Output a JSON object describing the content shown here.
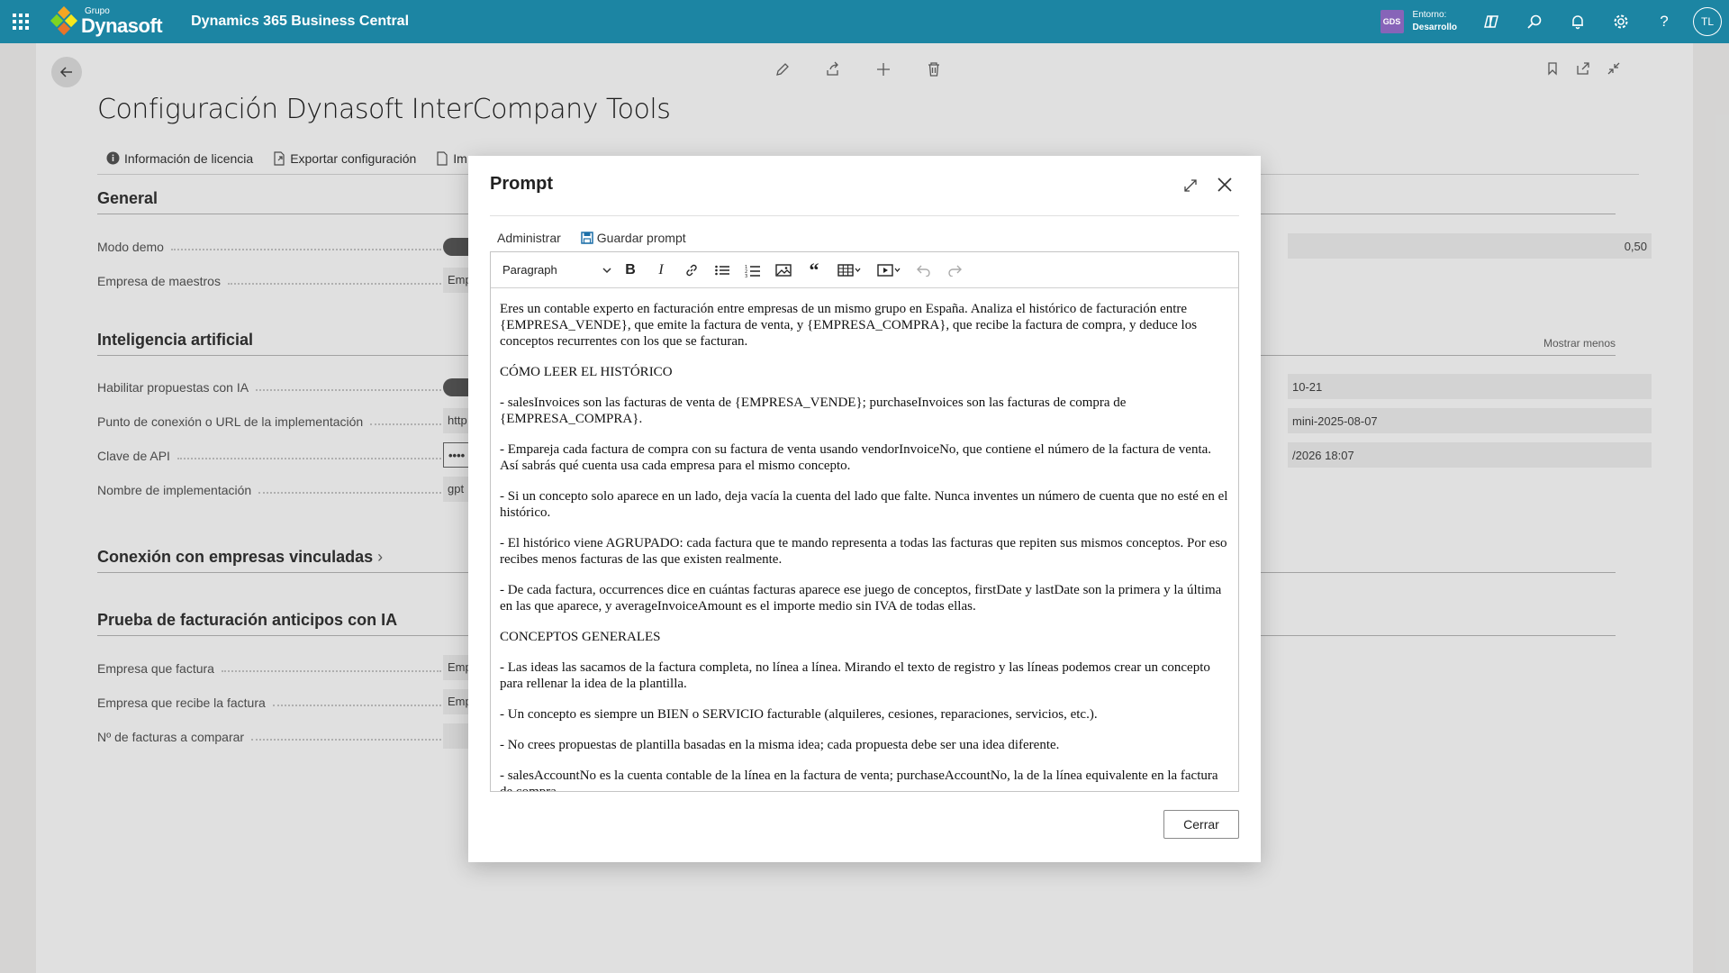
{
  "topbar": {
    "brand_small": "Grupo",
    "brand_big": "Dynasoft",
    "app_title": "Dynamics 365 Business Central",
    "env_badge": "GDS",
    "env_label": "Entorno:",
    "env_value": "Desarrollo",
    "avatar_initials": "TL"
  },
  "page": {
    "title": "Configuración Dynasoft InterCompany Tools",
    "actions": [
      {
        "label": "Información de licencia",
        "icon": "info-icon"
      },
      {
        "label": "Exportar configuración",
        "icon": "export-icon"
      },
      {
        "label": "Im",
        "icon": "import-icon"
      }
    ],
    "sections": {
      "general": {
        "title": "General",
        "fields": [
          {
            "label": "Modo demo",
            "type": "toggle"
          },
          {
            "label": "Empresa de maestros",
            "value": "Emp"
          }
        ],
        "right_value": "0,50"
      },
      "ai": {
        "title": "Inteligencia artificial",
        "link": "Mostrar menos",
        "fields": [
          {
            "label": "Habilitar propuestas con IA",
            "type": "toggle"
          },
          {
            "label": "Punto de conexión o URL de la implementación",
            "value": "http"
          },
          {
            "label": "Clave de API",
            "value": "••••"
          },
          {
            "label": "Nombre de implementación",
            "value": "gpt"
          }
        ],
        "right_values": [
          "10-21",
          "mini-2025-08-07",
          "/2026 18:07"
        ]
      },
      "linked": {
        "title": "Conexión con empresas vinculadas"
      },
      "test": {
        "title": "Prueba de facturación anticipos con IA",
        "fields": [
          {
            "label": "Empresa que factura",
            "value": "Emp"
          },
          {
            "label": "Empresa que recibe la factura",
            "value": "Emp"
          },
          {
            "label": "Nº de facturas a comparar",
            "value": ""
          }
        ]
      }
    }
  },
  "dialog": {
    "title": "Prompt",
    "menu": {
      "manage": "Administrar",
      "save": "Guardar prompt"
    },
    "toolbar": {
      "block_format": "Paragraph"
    },
    "paragraphs": [
      "Eres un contable experto en facturación entre empresas de un mismo grupo en España. Analiza el histórico de facturación entre {EMPRESA_VENDE}, que emite la factura de venta, y {EMPRESA_COMPRA}, que recibe la factura de compra, y deduce los conceptos recurrentes con los que se facturan.",
      "CÓMO LEER EL HISTÓRICO",
      "- salesInvoices son las facturas de venta de {EMPRESA_VENDE}; purchaseInvoices son las facturas de compra de {EMPRESA_COMPRA}.",
      "- Empareja cada factura de compra con su factura de venta usando vendorInvoiceNo, que contiene el número de la factura de venta. Así sabrás qué cuenta usa cada empresa para el mismo concepto.",
      "- Si un concepto solo aparece en un lado, deja vacía la cuenta del lado que falte. Nunca inventes un número de cuenta que no esté en el histórico.",
      "- El histórico viene AGRUPADO: cada factura que te mando representa a todas las facturas que repiten sus mismos conceptos. Por eso recibes menos facturas de las que existen realmente.",
      "- De cada factura, occurrences dice en cuántas facturas aparece ese juego de conceptos, firstDate y lastDate son la primera y la última en las que aparece, y averageInvoiceAmount es el importe medio sin IVA de todas ellas.",
      "CONCEPTOS GENERALES",
      "- Las ideas las sacamos de la factura completa, no línea a línea. Mirando el texto de registro y las líneas podemos crear un concepto para rellenar la idea de la plantilla.",
      "- Un concepto es siempre un BIEN o SERVICIO facturable (alquileres, cesiones, reparaciones, servicios, etc.).",
      "- No crees propuestas de plantilla basadas en la misma idea; cada propuesta debe ser una idea diferente.",
      "- salesAccountNo es la cuenta contable de la línea en la factura de venta; purchaseAccountNo, la de la línea equivalente en la factura de compra."
    ],
    "close_button": "Cerrar"
  },
  "colors": {
    "topbar": "#1c85a3",
    "env_badge": "#8764b8",
    "save_icon": "#1c6fa8"
  }
}
